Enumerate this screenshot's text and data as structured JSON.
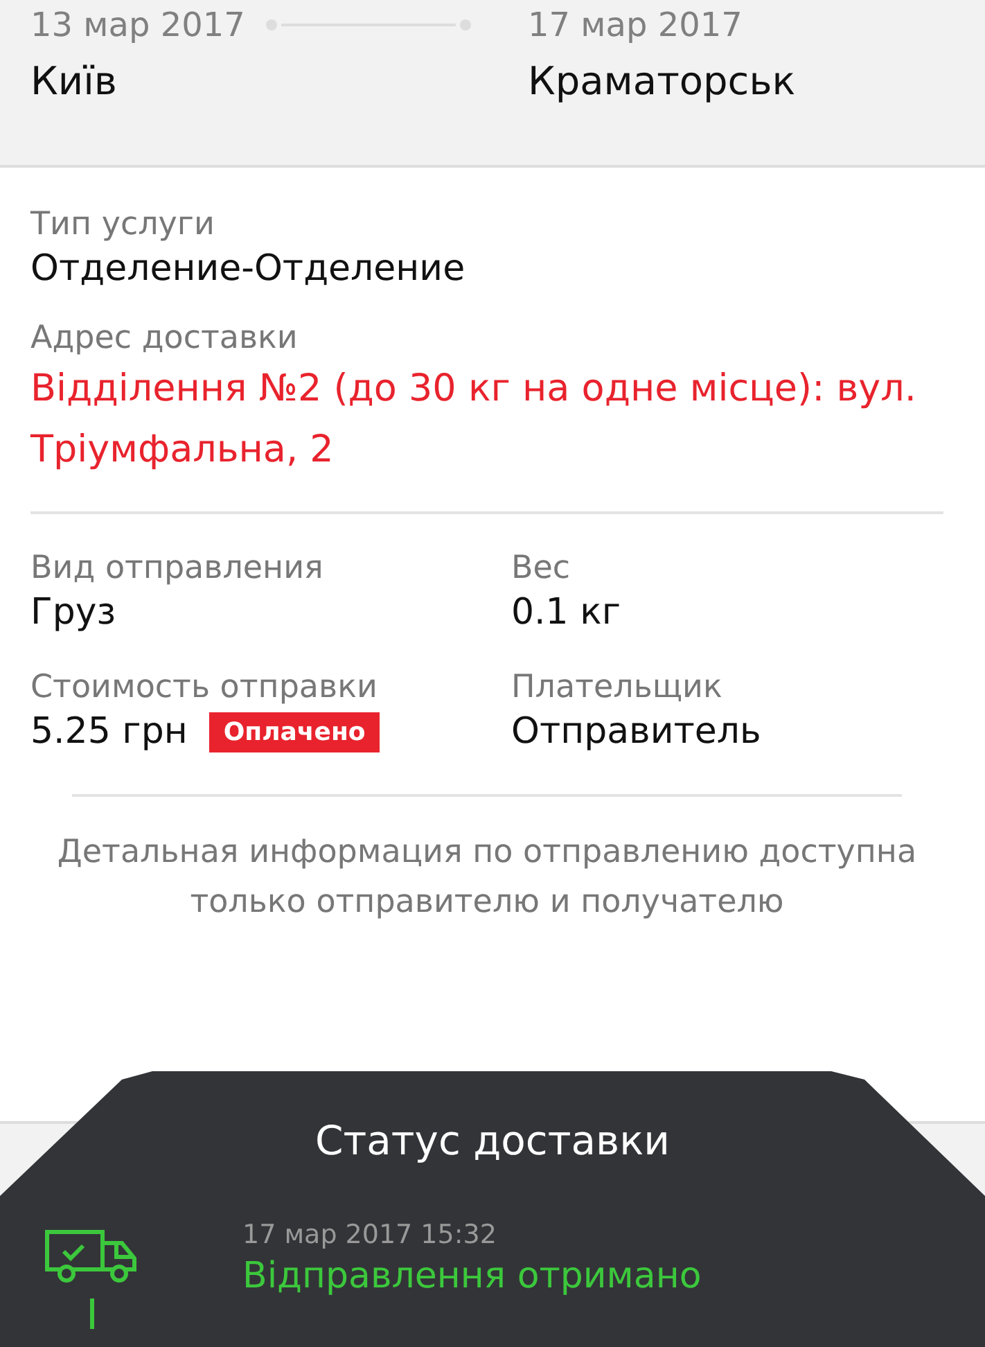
{
  "route": {
    "from": {
      "date": "13 мар 2017",
      "city": "Київ"
    },
    "to": {
      "date": "17 мар 2017",
      "city": "Краматорськ"
    }
  },
  "service": {
    "label": "Тип услуги",
    "value": "Отделение-Отделение"
  },
  "address": {
    "label": "Адрес доставки",
    "value": "Відділення №2 (до 30 кг на одне місце): вул. Тріумфальна, 2"
  },
  "details": [
    {
      "label": "Вид отправления",
      "value": "Груз"
    },
    {
      "label": "Вес",
      "value": "0.1 кг"
    },
    {
      "label": "Стоимость отправки",
      "value": "5.25 грн",
      "badge": "Оплачено"
    },
    {
      "label": "Плательщик",
      "value": "Отправитель"
    }
  ],
  "note": "Детальная информация по отправлению доступна только отправителю и получателю",
  "status": {
    "title": "Статус доставки",
    "events": [
      {
        "kind": "received",
        "time": "17 мар 2017 15:32",
        "text": "Відправлення отримано"
      }
    ]
  }
}
